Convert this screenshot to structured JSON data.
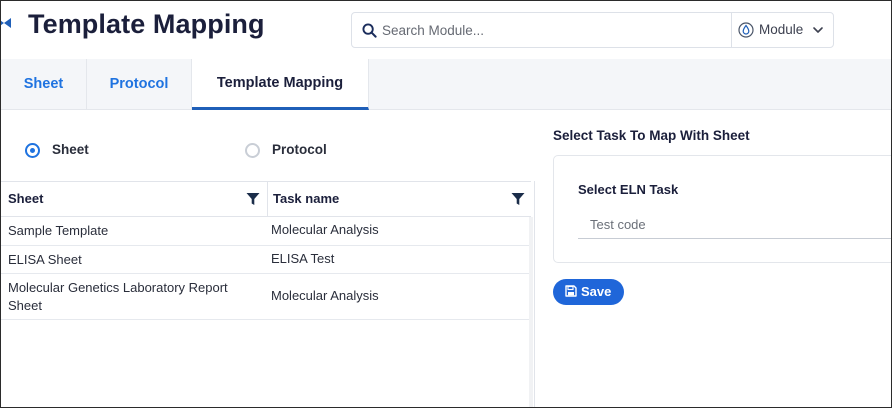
{
  "header": {
    "title": "Template Mapping",
    "search": {
      "placeholder": "Search Module..."
    },
    "module_select": {
      "label": "Module"
    }
  },
  "tabs": [
    {
      "label": "Sheet",
      "active": false
    },
    {
      "label": "Protocol",
      "active": false
    },
    {
      "label": "Template Mapping",
      "active": true
    }
  ],
  "mapping_type": {
    "options": [
      {
        "label": "Sheet",
        "checked": true
      },
      {
        "label": "Protocol",
        "checked": false
      }
    ]
  },
  "grid": {
    "columns": [
      "Sheet",
      "Task name"
    ],
    "rows": [
      {
        "sheet": "Sample Template",
        "task": "Molecular Analysis"
      },
      {
        "sheet": "ELISA Sheet",
        "task": "ELISA Test"
      },
      {
        "sheet": "Molecular Genetics Laboratory Report Sheet",
        "task": "Molecular Analysis"
      }
    ]
  },
  "mapping_panel": {
    "title": "Select Task To Map With Sheet",
    "eln_label": "Select ELN Task",
    "eln_placeholder": "Test code",
    "save_label": "Save"
  },
  "colors": {
    "accent": "#1f73e0",
    "button": "#1f66d9",
    "title": "#1b1f3b",
    "tabbar_bg": "#f4f6f9"
  }
}
